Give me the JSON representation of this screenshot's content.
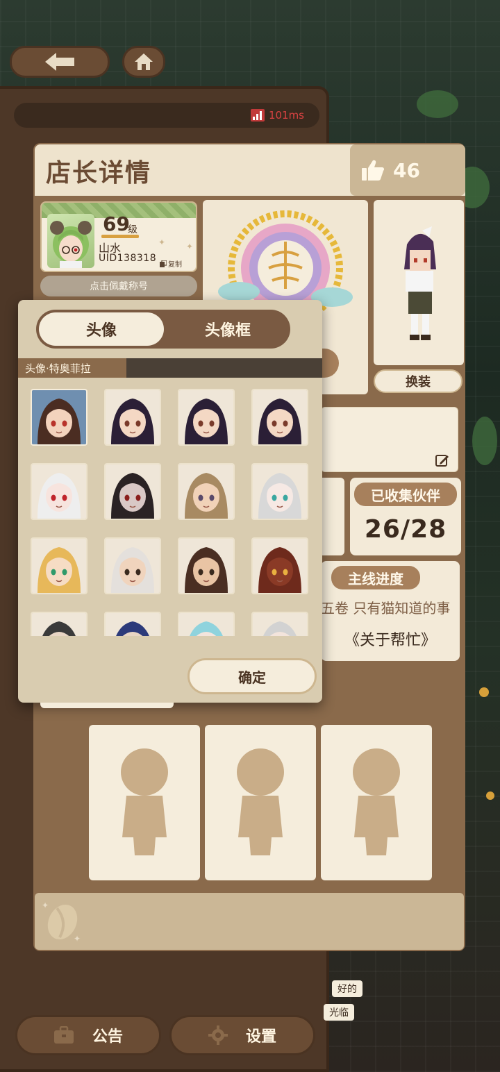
{
  "status": {
    "ping": "101ms"
  },
  "header": {
    "title": "店长详情",
    "likes": "46"
  },
  "profile": {
    "level": "69",
    "level_unit": "级",
    "name": "山水",
    "uid": "UID138318",
    "copy_label": "复制",
    "title_button": "点击佩戴称号"
  },
  "dress_button": "换装",
  "collection": {
    "label": "已收集伙伴",
    "count": "26/28"
  },
  "story": {
    "label": "主线进度",
    "volume": "五卷 只有猫知道的事",
    "chapter": "《关于帮忙》"
  },
  "dialog": {
    "tabs": [
      {
        "label": "头像",
        "active": true
      },
      {
        "label": "头像框",
        "active": false
      }
    ],
    "selected_label": "头像·特奥菲拉",
    "confirm_button": "确定",
    "avatars": [
      {
        "name": "avatar-1",
        "bg": "#6f8fb0",
        "hair": "#4b2d22",
        "skin": "#f3d3bd",
        "eyes": "#b8322a",
        "selected": true
      },
      {
        "name": "avatar-2",
        "bg": "#efe6d8",
        "hair": "#2b1f36",
        "skin": "#f4d8c4",
        "eyes": "#7a3a2a"
      },
      {
        "name": "avatar-3",
        "bg": "#efe6d8",
        "hair": "#2b1f36",
        "skin": "#f4d8c4",
        "eyes": "#7a3a2a"
      },
      {
        "name": "avatar-4",
        "bg": "#efe6d8",
        "hair": "#2b1f36",
        "skin": "#f4d8c4",
        "eyes": "#7a3a2a"
      },
      {
        "name": "avatar-5",
        "bg": "#efe6d8",
        "hair": "#eeeeee",
        "skin": "#f7e4de",
        "eyes": "#c0242a"
      },
      {
        "name": "avatar-6",
        "bg": "#efe6d8",
        "hair": "#2a2224",
        "skin": "#d9c8c6",
        "eyes": "#8a1d1d"
      },
      {
        "name": "avatar-7",
        "bg": "#efe6d8",
        "hair": "#a88a62",
        "skin": "#f1d2b8",
        "eyes": "#5a4a6a"
      },
      {
        "name": "avatar-8",
        "bg": "#efe6d8",
        "hair": "#d8d8d8",
        "skin": "#f6e9e4",
        "eyes": "#3aa7a0"
      },
      {
        "name": "avatar-9",
        "bg": "#efe6d8",
        "hair": "#e7b85a",
        "skin": "#f6dcc4",
        "eyes": "#2f9a6a"
      },
      {
        "name": "avatar-10",
        "bg": "#efe6d8",
        "hair": "#e4e0dc",
        "skin": "#f0d4bd",
        "eyes": "#3a2a1e"
      },
      {
        "name": "avatar-11",
        "bg": "#efe6d8",
        "hair": "#4a2e22",
        "skin": "#e9c4a4",
        "eyes": "#3a2a1e"
      },
      {
        "name": "avatar-12",
        "bg": "#efe6d8",
        "hair": "#6e2a1c",
        "skin": "#8a3a26",
        "eyes": "#e9b040"
      },
      {
        "name": "avatar-13",
        "bg": "#efe6d8",
        "hair": "#3a3a3a",
        "skin": "#e8d5c4",
        "eyes": "#3a2a1e"
      },
      {
        "name": "avatar-14",
        "bg": "#efe6d8",
        "hair": "#2c3a7a",
        "skin": "#e8d5c4",
        "eyes": "#3a2a1e"
      },
      {
        "name": "avatar-15",
        "bg": "#efe6d8",
        "hair": "#8fd3dd",
        "skin": "#f3e4dc",
        "eyes": "#3a2a1e"
      },
      {
        "name": "avatar-16",
        "bg": "#efe6d8",
        "hair": "#d2d2d2",
        "skin": "#f3e4dc",
        "eyes": "#3a2a1e"
      }
    ]
  },
  "chat": [
    "好的",
    "光临"
  ],
  "bottom_nav": [
    {
      "label": "公告",
      "icon": "briefcase-icon"
    },
    {
      "label": "设置",
      "icon": "gear-icon"
    }
  ],
  "colors": {
    "panel": "#8a6a4b",
    "card": "#f5eddc",
    "accent": "#a7805c",
    "text_dark": "#4a3322"
  }
}
